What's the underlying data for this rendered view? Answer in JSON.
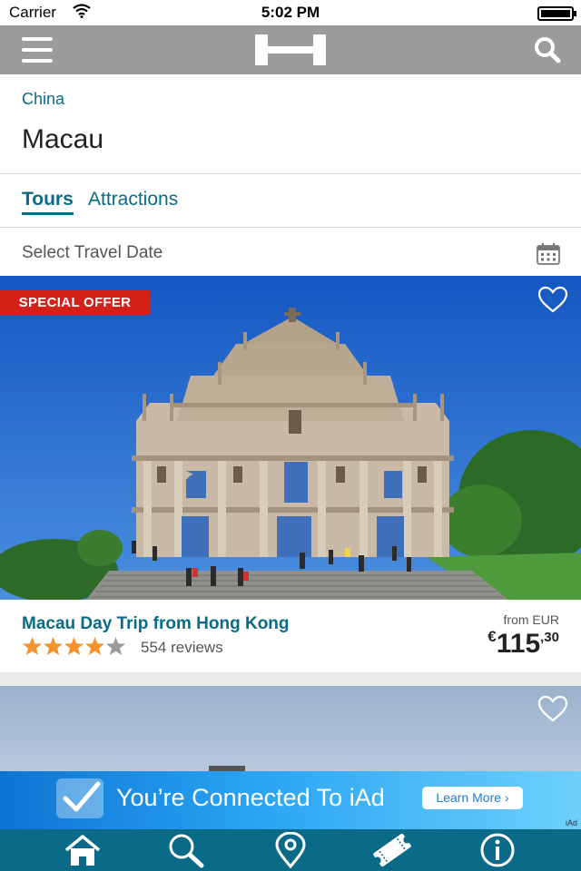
{
  "status_bar": {
    "carrier": "Carrier",
    "time": "5:02 PM"
  },
  "nav": {
    "menu_icon": "hamburger-menu-icon",
    "logo_icon": "h-logo-icon",
    "search_icon": "search-icon",
    "bg_color": "#999b9d"
  },
  "location": {
    "breadcrumb": "China",
    "title": "Macau"
  },
  "tabs": [
    {
      "label": "Tours",
      "active": true
    },
    {
      "label": "Attractions",
      "active": false
    }
  ],
  "date_select": {
    "label": "Select Travel Date",
    "icon": "calendar-icon"
  },
  "tours": [
    {
      "badge": "SPECIAL OFFER",
      "title": "Macau Day Trip from Hong Kong",
      "rating": 4.5,
      "reviews": "554 reviews",
      "price_prefix": "from EUR",
      "price_currency": "€",
      "price_main": "115",
      "price_cents": ",30",
      "favorite_icon": "heart-outline-icon"
    },
    {
      "favorite_icon": "heart-outline-icon"
    }
  ],
  "ad": {
    "text": "You’re Connected To iAd",
    "button": "Learn More ›",
    "label": "iAd"
  },
  "tab_bar": {
    "color": "#0a6a87",
    "items": [
      "home-icon",
      "search-icon",
      "location-pin-icon",
      "ticket-icon",
      "info-icon"
    ]
  },
  "colors": {
    "accent": "#0a6a87",
    "badge": "#d42019",
    "star": "#f7932d"
  }
}
